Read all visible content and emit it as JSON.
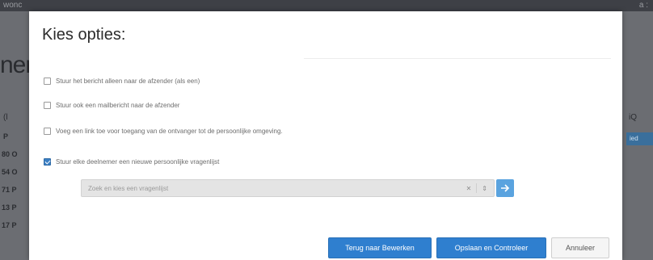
{
  "background": {
    "topbar_left": "wonc",
    "topbar_right": "a :",
    "page_title": "ner",
    "left_label_1": "(l",
    "left_label_2": "P",
    "left_rows": [
      "80 O",
      "54 O",
      "71 P",
      "13 P",
      "17 P"
    ],
    "right_label": "iQ",
    "right_tag": "ied"
  },
  "modal": {
    "title": "Kies opties:",
    "options": [
      {
        "label": "Stuur het bericht alleen naar de afzender (als een)",
        "checked": false
      },
      {
        "label": "Stuur ook een mailbericht naar de afzender",
        "checked": false
      },
      {
        "label": "Voeg een link toe voor toegang van de ontvanger tot de persoonlijke omgeving.",
        "checked": false
      },
      {
        "label": "Stuur elke deelnemer een nieuwe persoonlijke vragenlijst",
        "checked": true
      }
    ],
    "select": {
      "value": "Zoek en kies een vragenlijst",
      "clear_icon": "clear-x-icon",
      "chevron_icon": "chevron-updown-icon"
    },
    "go_button_icon": "arrow-right-icon",
    "buttons": {
      "back": "Terug naar Bewerken",
      "save": "Opslaan en Controleer",
      "cancel": "Annuleer"
    }
  },
  "colors": {
    "primary": "#2f7fcf",
    "checkbox_checked": "#3b7fc4",
    "overlay": "#5f6166"
  }
}
